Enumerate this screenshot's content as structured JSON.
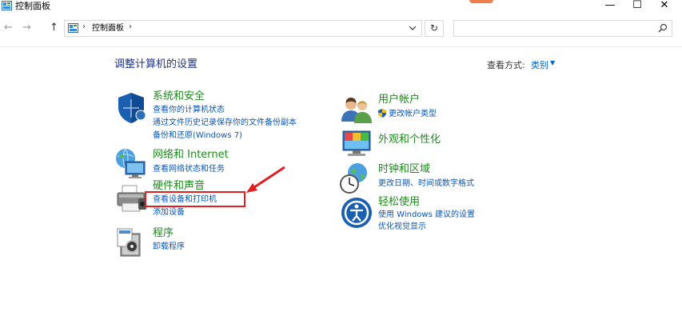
{
  "window": {
    "title": "控制面板",
    "minimize": "—",
    "maximize": "☐",
    "close": "✕"
  },
  "nav": {
    "back": "←",
    "forward": "→",
    "up": "↑",
    "breadcrumb_sep": "›",
    "breadcrumb": "控制面板",
    "refresh": "↻",
    "search_placeholder": ""
  },
  "main": {
    "title": "调整计算机的设置",
    "view_by_label": "查看方式:",
    "view_by_value": "类别",
    "view_by_caret": "▼"
  },
  "categories": {
    "system": {
      "title": "系统和安全",
      "links": [
        "查看你的计算机状态",
        "通过文件历史记录保存你的文件备份副本",
        "备份和还原(Windows 7)"
      ]
    },
    "network": {
      "title": "网络和 Internet",
      "links": [
        "查看网络状态和任务"
      ]
    },
    "hardware": {
      "title": "硬件和声音",
      "links": [
        "查看设备和打印机",
        "添加设备"
      ]
    },
    "programs": {
      "title": "程序",
      "links": [
        "卸载程序"
      ]
    },
    "users": {
      "title": "用户帐户",
      "links": [
        "更改帐户类型"
      ]
    },
    "appearance": {
      "title": "外观和个性化",
      "links": []
    },
    "clock": {
      "title": "时钟和区域",
      "links": [
        "更改日期、时间或数字格式"
      ]
    },
    "ease": {
      "title": "轻松使用",
      "links": [
        "使用 Windows 建议的设置",
        "优化视觉显示"
      ]
    }
  },
  "colors": {
    "title_blue": "#1e3287",
    "category_green": "#1e8a1e",
    "link_blue": "#0b57b4",
    "highlight_red": "#e02020"
  }
}
